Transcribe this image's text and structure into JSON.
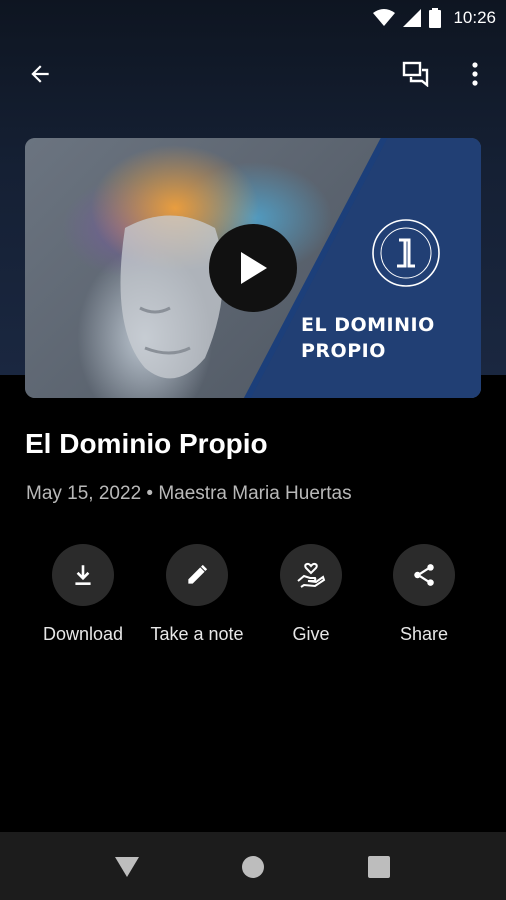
{
  "status_bar": {
    "time": "10:26"
  },
  "media": {
    "overlay_title": "EL DOMINIO PROPIO",
    "play_icon": "play-icon"
  },
  "episode": {
    "title": "El Dominio Propio",
    "meta": "May 15, 2022 • Maestra Maria Huertas"
  },
  "actions": [
    {
      "label": "Download",
      "icon": "download-icon"
    },
    {
      "label": "Take a note",
      "icon": "pencil-icon"
    },
    {
      "label": "Give",
      "icon": "give-hand-heart-icon"
    },
    {
      "label": "Share",
      "icon": "share-icon"
    }
  ],
  "colors": {
    "header_top": "#0e1521",
    "header_bottom": "#1a2740",
    "panel_blue": "#213f74",
    "action_circle": "#2b2b2b",
    "background": "#000000"
  }
}
